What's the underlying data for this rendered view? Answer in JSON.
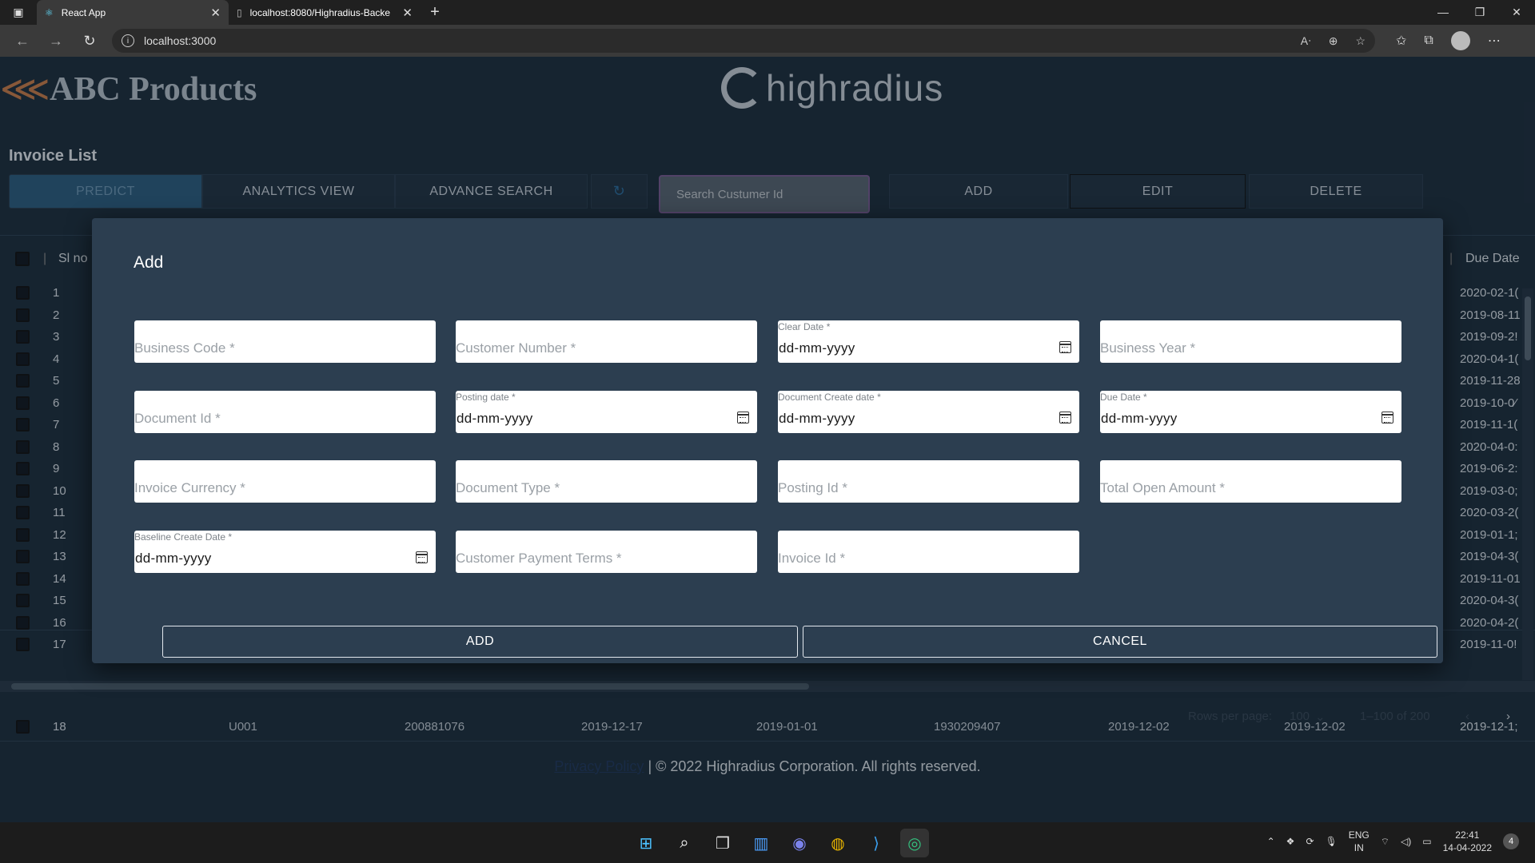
{
  "browser": {
    "tabs": [
      {
        "label": "React App",
        "active": true
      },
      {
        "label": "localhost:8080/Highradius-Backe",
        "active": false
      }
    ],
    "address": "localhost:3000"
  },
  "app": {
    "brand_name": "ABC Products",
    "partner_logo": "highradius",
    "page_title": "Invoice List",
    "toolbar": {
      "predict": "PREDICT",
      "analytics": "ANALYTICS VIEW",
      "advance_search": "ADVANCE SEARCH",
      "search_placeholder": "Search Custumer Id",
      "add": "ADD",
      "edit": "EDIT",
      "delete": "DELETE"
    },
    "table": {
      "headers": {
        "slno": "Sl no",
        "due_date": "Due Date"
      },
      "rows": [
        {
          "slno": "1",
          "due": "2020-02-1("
        },
        {
          "slno": "2",
          "due": "2019-08-11"
        },
        {
          "slno": "3",
          "due": "2019-09-2!"
        },
        {
          "slno": "4",
          "due": "2020-04-1("
        },
        {
          "slno": "5",
          "due": "2019-11-28"
        },
        {
          "slno": "6",
          "due": "2019-10-0⁄"
        },
        {
          "slno": "7",
          "due": "2019-11-1("
        },
        {
          "slno": "8",
          "due": "2020-04-0:"
        },
        {
          "slno": "9",
          "due": "2019-06-2:"
        },
        {
          "slno": "10",
          "due": "2019-03-0;"
        },
        {
          "slno": "11",
          "due": "2020-03-2("
        },
        {
          "slno": "12",
          "due": "2019-01-1;"
        },
        {
          "slno": "13",
          "due": "2019-04-3("
        },
        {
          "slno": "14",
          "due": "2019-11-01"
        },
        {
          "slno": "15",
          "due": "2020-04-3("
        },
        {
          "slno": "16",
          "due": "2020-04-2("
        },
        {
          "slno": "17",
          "due": "2019-11-0!"
        }
      ],
      "last_row": {
        "slno": "18",
        "business_code": "U001",
        "customer_number": "200881076",
        "clear_date": "2019-12-17",
        "posting_date": "2019-01-01",
        "document_id": "1930209407",
        "doc_create_date": "2019-12-02",
        "due_in_date": "2019-12-02",
        "due": "2019-12-1;"
      }
    },
    "pagination": {
      "rows_per_page_label": "Rows per page:",
      "rows_per_page": "100",
      "range": "1–100 of 200"
    },
    "footer": {
      "privacy": "Privacy Policy",
      "copyright": "| © 2022 Highradius Corporation. All rights reserved."
    }
  },
  "modal": {
    "title": "Add",
    "fields": {
      "business_code": "Business Code *",
      "customer_number": "Customer Number *",
      "clear_date_label": "Clear Date *",
      "business_year": "Business Year *",
      "document_id": "Document Id *",
      "posting_date_label": "Posting date *",
      "document_create_date_label": "Document Create date *",
      "due_date_label": "Due Date *",
      "invoice_currency": "Invoice Currency *",
      "document_type": "Document Type *",
      "posting_id": "Posting Id *",
      "total_open_amount": "Total Open Amount *",
      "baseline_create_date_label": "Baseline Create Date *",
      "customer_payment_terms": "Customer Payment Terms *",
      "invoice_id": "Invoice Id *",
      "date_placeholder": "dd-mm-yyyy"
    },
    "add_button": "ADD",
    "cancel_button": "CANCEL"
  },
  "taskbar": {
    "language": "ENG",
    "region": "IN",
    "time": "22:41",
    "date": "14-04-2022",
    "notifications": "4"
  }
}
